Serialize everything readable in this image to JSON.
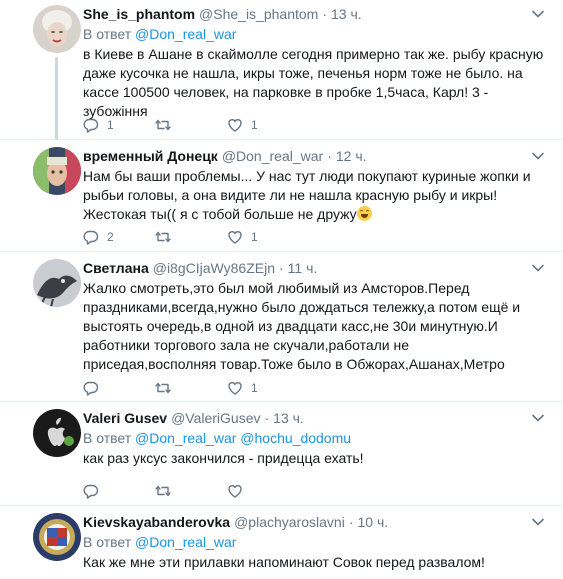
{
  "tweets": [
    {
      "name": "She_is_phantom",
      "handle": "@She_is_phantom",
      "time": "13 ч.",
      "reply_prefix": "В ответ",
      "reply_mentions": [
        "@Don_real_war"
      ],
      "text": "в Киеве в Ашане в скаймолле сегодня примерно так же. рыбу красную даже кусочка не нашла, икры тоже, печенья норм тоже не было. на кассе 100500 человек, на парковке в пробке 1,5часа, Карл! 3 - зубожіння",
      "replies": "1",
      "retweets": "",
      "likes": "1"
    },
    {
      "name": "временный Донецк",
      "handle": "@Don_real_war",
      "time": "12 ч.",
      "text": "Нам бы ваши проблемы... У нас тут люди покупают куриные жопки и рыбьи головы, а она видите ли не нашла красную рыбу и икры! Жестокая ты(( я с тобой больше не дружу",
      "replies": "2",
      "retweets": "",
      "likes": "1"
    },
    {
      "name": "Светлана",
      "handle": "@i8gCIjaWy86ZEjn",
      "time": "11 ч.",
      "text": "Жалко смотреть,это был мой любимый из Амсторов.Перед праздниками,всегда,нужно было дождаться тележку,а потом ещё и выстоять очередь,в одной из двадцати касс,не 30и минутную.И работники торгового зала не скучали,работали не приседая,восполняя товар.Тоже было в Обжорах,Ашанах,Метро",
      "replies": "",
      "retweets": "",
      "likes": "1"
    },
    {
      "name": "Valeri Gusev",
      "handle": "@ValeriGusev",
      "time": "13 ч.",
      "reply_prefix": "В ответ",
      "reply_mentions": [
        "@Don_real_war",
        "@hochu_dodomu"
      ],
      "text": "как раз уксус закончился - придецца ехать!",
      "replies": "",
      "retweets": "",
      "likes": ""
    },
    {
      "name": "Kievskayabanderovka",
      "handle": "@plachyaroslavni",
      "time": "10 ч.",
      "reply_prefix": "В ответ",
      "reply_mentions": [
        "@Don_real_war"
      ],
      "text": "Как же мне эти прилавки напоминают Совок перед развалом!"
    }
  ],
  "icons": {
    "reply": "reply-icon",
    "retweet": "retweet-icon",
    "like": "heart-icon",
    "caret": "chevron-down-icon"
  },
  "colors": {
    "link": "#1b95e0",
    "secondary": "#657786",
    "divider": "#e6ecf0"
  }
}
